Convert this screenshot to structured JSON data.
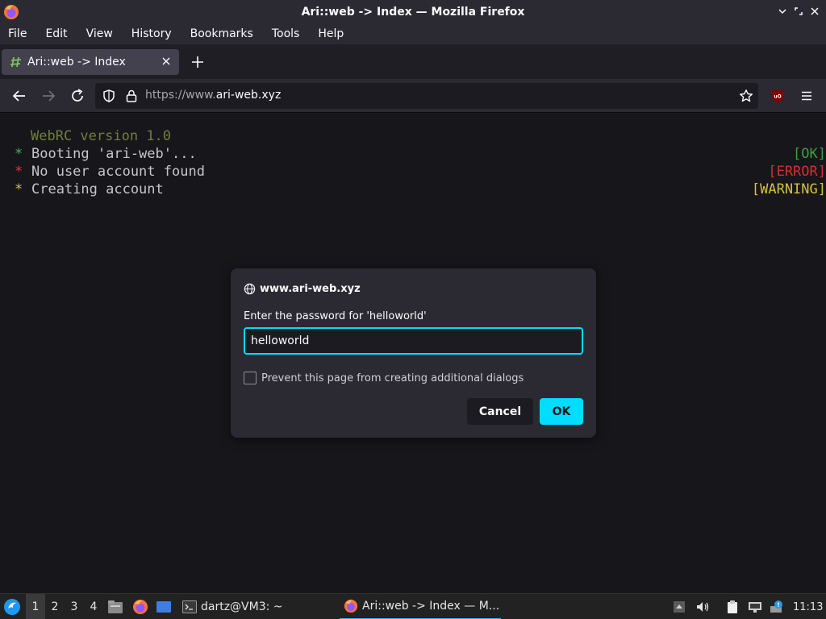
{
  "window": {
    "title": "Ari::web -> Index — Mozilla Firefox"
  },
  "menubar": {
    "items": [
      {
        "label": "File",
        "accel": "F",
        "rest": "ile"
      },
      {
        "label": "Edit",
        "accel": "E",
        "rest": "dit"
      },
      {
        "label": "View",
        "accel": "V",
        "rest": "iew"
      },
      {
        "label": "History",
        "accel": "s",
        "pre": "Hi",
        "rest": "tory"
      },
      {
        "label": "Bookmarks",
        "accel": "B",
        "rest": "ookmarks"
      },
      {
        "label": "Tools",
        "accel": "T",
        "rest": "ools"
      },
      {
        "label": "Help",
        "accel": "H",
        "rest": "elp"
      }
    ]
  },
  "tabs": [
    {
      "label": "Ari::web -> Index",
      "active": true
    }
  ],
  "navbar": {
    "url_prefix": "https://www.",
    "url_host": "ari-web.xyz"
  },
  "page": {
    "version_line": "WebRC version 1.0",
    "lines": [
      {
        "bullet": "*",
        "text": "Booting 'ari-web'...",
        "status": "[OK]",
        "bullet_color": "#4caf50",
        "status_color": "#3f9f3f"
      },
      {
        "bullet": "*",
        "text": "No user account found",
        "status": "[ERROR]",
        "bullet_color": "#e53935",
        "status_color": "#d32f2f"
      },
      {
        "bullet": "*",
        "text": "Creating account",
        "status": "[WARNING]",
        "bullet_color": "#d4c13d",
        "status_color": "#d4c13d"
      }
    ]
  },
  "dialog": {
    "origin": "www.ari-web.xyz",
    "prompt": "Enter the password for 'helloworld'",
    "password_value": "helloworld",
    "checkbox_label": "Prevent this page from creating additional dialogs",
    "checkbox_checked": false,
    "cancel_label": "Cancel",
    "ok_label": "OK"
  },
  "taskbar": {
    "workspaces": [
      "1",
      "2",
      "3",
      "4"
    ],
    "active_workspace": "1",
    "tasks": [
      {
        "label": "dartz@VM3: ~",
        "icon": "terminal-icon"
      },
      {
        "label": "Ari::web -> Index — M...",
        "icon": "firefox-icon",
        "active": true
      }
    ],
    "clock": "11:13"
  },
  "colors": {
    "accent": "#00ddff",
    "toolbar": "#2b2a33",
    "page_bg": "#17161b"
  }
}
